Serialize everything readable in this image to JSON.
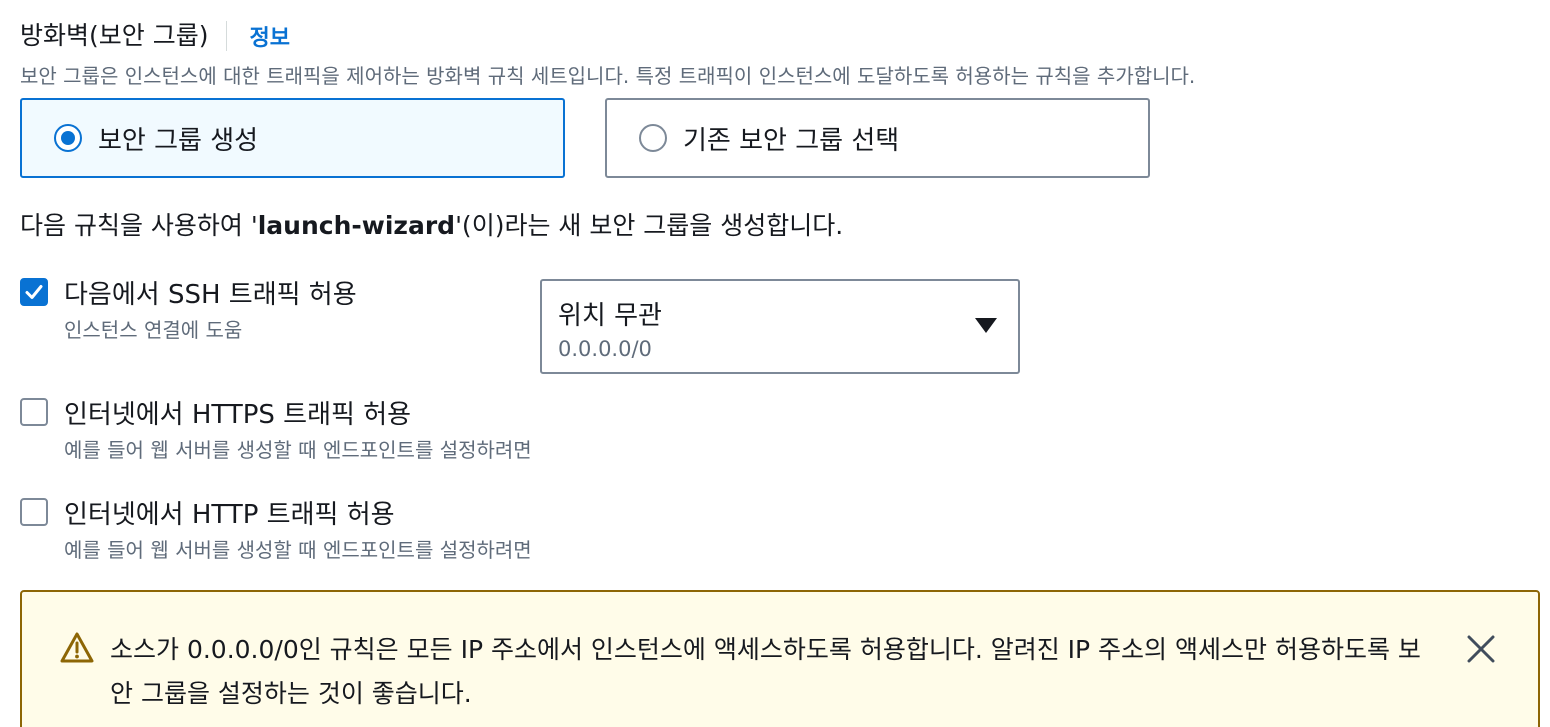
{
  "header": {
    "title": "방화벽(보안 그룹)",
    "info_link": "정보"
  },
  "description": "보안 그룹은 인스턴스에 대한 트래픽을 제어하는 방화벽 규칙 세트입니다. 특정 트래픽이 인스턴스에 도달하도록 허용하는 규칙을 추가합니다.",
  "tiles": {
    "create": {
      "label": "보안 그룹 생성",
      "selected": true
    },
    "existing": {
      "label": "기존 보안 그룹 선택",
      "selected": false
    }
  },
  "rule_sentence": {
    "prefix": "다음 규칙을 사용하여 '",
    "name": "launch-wizard",
    "suffix": "'(이)라는 새 보안 그룹을 생성합니다."
  },
  "rules": {
    "ssh": {
      "label": "다음에서 SSH 트래픽 허용",
      "description": "인스턴스 연결에 도움",
      "checked": true
    },
    "https": {
      "label": "인터넷에서 HTTPS 트래픽 허용",
      "description": "예를 들어 웹 서버를 생성할 때 엔드포인트를 설정하려면",
      "checked": false
    },
    "http": {
      "label": "인터넷에서 HTTP 트래픽 허용",
      "description": "예를 들어 웹 서버를 생성할 때 엔드포인트를 설정하려면",
      "checked": false
    }
  },
  "source_select": {
    "value": "위치 무관",
    "sub": "0.0.0.0/0"
  },
  "alert": {
    "type": "warning",
    "text": "소스가 0.0.0.0/0인 규칙은 모든 IP 주소에서 인스턴스에 액세스하도록 허용합니다. 알려진 IP 주소의 액세스만 허용하도록 보안 그룹을 설정하는 것이 좋습니다."
  },
  "icons": {
    "warning": "warning-icon",
    "close": "close-icon",
    "caret": "caret-down-icon",
    "check": "check-icon"
  },
  "colors": {
    "accent": "#0972d3",
    "warning_border": "#8d6605",
    "warning_bg": "#fffce9"
  }
}
